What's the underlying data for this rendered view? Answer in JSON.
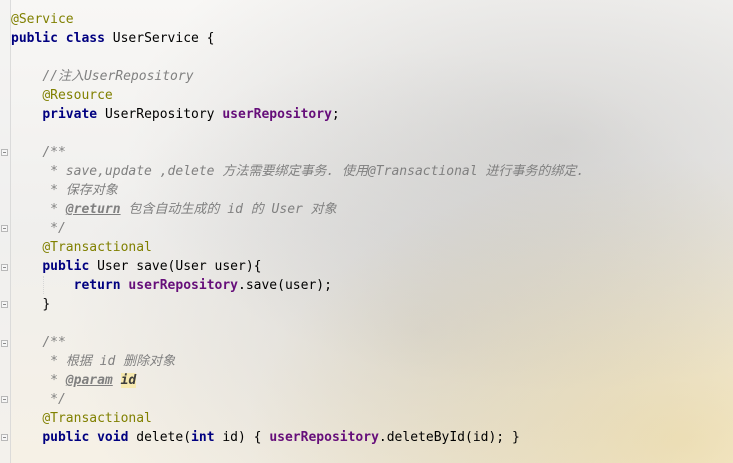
{
  "code": {
    "service_annotation": "@Service",
    "kw_public": "public",
    "kw_class": "class",
    "class_name": "UserService",
    "brace_open": " {",
    "comment_inject": "//注入UserRepository",
    "resource_annotation": "@Resource",
    "kw_private": "private",
    "repo_type": "UserRepository",
    "repo_field": "userRepository",
    "semicolon": ";",
    "doc_open": "/**",
    "doc1_line1": " * save,update ,delete 方法需要绑定事务. 使用@Transactional 进行事务的绑定.",
    "doc1_line2": " * 保存对象",
    "doc1_tag_prefix": " * ",
    "doc1_return_tag": "@return",
    "doc1_return_text": " 包含自动生成的 id 的 User 对象",
    "doc_close": " */",
    "transactional_annotation": "@Transactional",
    "save_signature": "User save(User user){",
    "kw_return": "return",
    "save_call": ".save(user);",
    "brace_close": "}",
    "doc2_line1": " * 根据 id 删除对象",
    "doc2_param_tag": "@param",
    "doc2_param_name": "id",
    "kw_void": "void",
    "delete_name": "delete",
    "paren_open": "(",
    "kw_int": "int",
    "delete_params_rest": " id) { ",
    "delete_call": ".deleteById(id); }"
  }
}
